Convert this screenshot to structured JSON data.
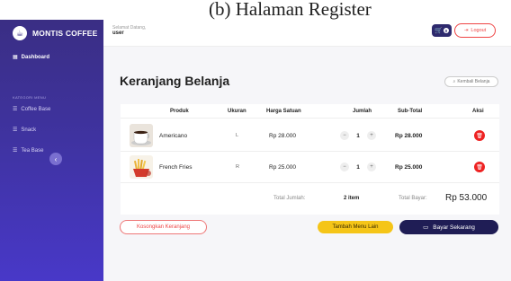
{
  "caption": "(b) Halaman Register",
  "brand": {
    "name": "MONTIS COFFEE"
  },
  "sidebar": {
    "section_label": "KATEGORI MENU",
    "items": [
      {
        "label": "Dashboard",
        "icon": "grid-icon",
        "active": true
      },
      {
        "label": "Coffee Base",
        "icon": "list-icon"
      },
      {
        "label": "Snack",
        "icon": "list-icon"
      },
      {
        "label": "Tea Base",
        "icon": "list-icon"
      }
    ]
  },
  "topbar": {
    "greeting": "Selamat Datang,",
    "username": "user",
    "cart_count": "0",
    "logout_label": "Logout"
  },
  "page": {
    "title": "Keranjang Belanja",
    "back_label": "Kembali Belanja"
  },
  "table": {
    "headers": [
      "Produk",
      "Ukuran",
      "Harga Satuan",
      "Jumlah",
      "Sub-Total",
      "Aksi"
    ],
    "rows": [
      {
        "name": "Americano",
        "size": "L",
        "price": "Rp 28.000",
        "qty": "1",
        "subtotal": "Rp 28.000"
      },
      {
        "name": "French Fries",
        "size": "R",
        "price": "Rp 25.000",
        "qty": "1",
        "subtotal": "Rp 25.000"
      }
    ],
    "total_qty_label": "Total Jumlah:",
    "total_qty": "2 item",
    "total_pay_label": "Total Bayar:",
    "total_pay": "Rp 53.000"
  },
  "actions": {
    "empty_label": "Kosongkan Keranjang",
    "add_label": "Tambah Menu Lain",
    "pay_label": "Bayar Sekarang"
  },
  "colors": {
    "sidebar": "#3f33a0",
    "accent": "#1f1d55",
    "danger": "#e22222",
    "warning": "#f5c518"
  }
}
